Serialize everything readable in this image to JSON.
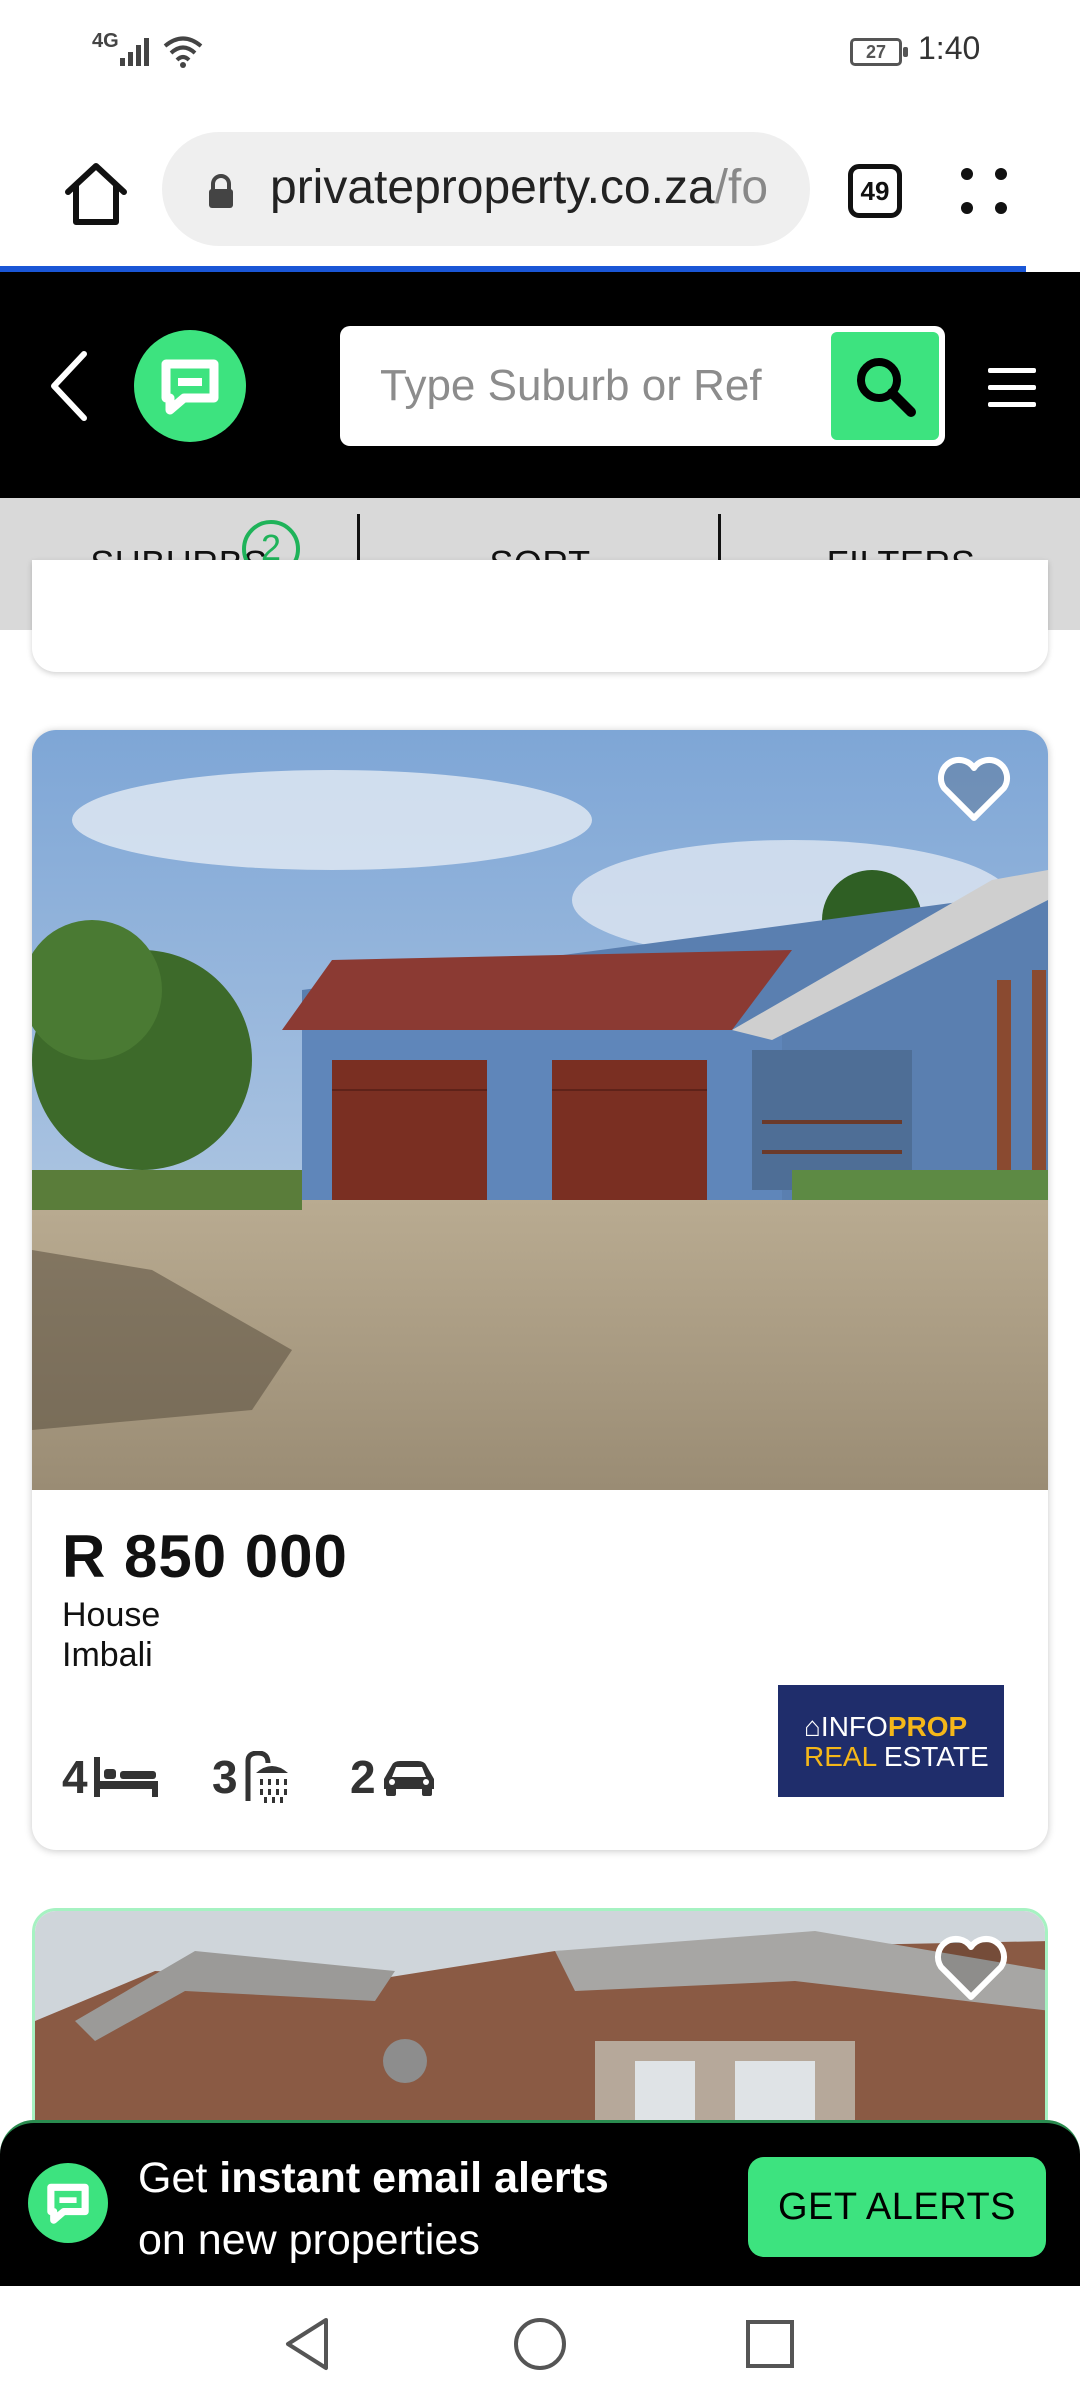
{
  "status_bar": {
    "network": "4G",
    "battery": "27",
    "time": "1:40"
  },
  "browser": {
    "url_host": "privateproperty.co.za",
    "url_path": "/fo",
    "tab_count": "49",
    "load_progress_fraction": 0.95
  },
  "header": {
    "search_placeholder": "Type Suburb or Ref"
  },
  "filters": {
    "suburbs_label": "SUBURBS",
    "suburbs_count": "2",
    "sort_label": "SORT",
    "filters_label": "FILTERS"
  },
  "listing": {
    "price": "R 850 000",
    "type": "House",
    "suburb": "Imbali",
    "bedrooms": "4",
    "bathrooms": "3",
    "garages": "2",
    "agency": {
      "line1_a": "INFO",
      "line1_b": "PROP",
      "line2_a": "REAL",
      "line2_b": " ESTATE"
    }
  },
  "alert_banner": {
    "text_prefix": "Get ",
    "text_bold": "instant email alerts",
    "text_line2": "on new properties",
    "button_label": "GET ALERTS"
  },
  "colors": {
    "brand_green": "#3de37f",
    "header_black": "#000000",
    "agency_navy": "#1f2d6b",
    "agency_gold": "#f5b719",
    "progress_blue": "#1a56d6"
  }
}
